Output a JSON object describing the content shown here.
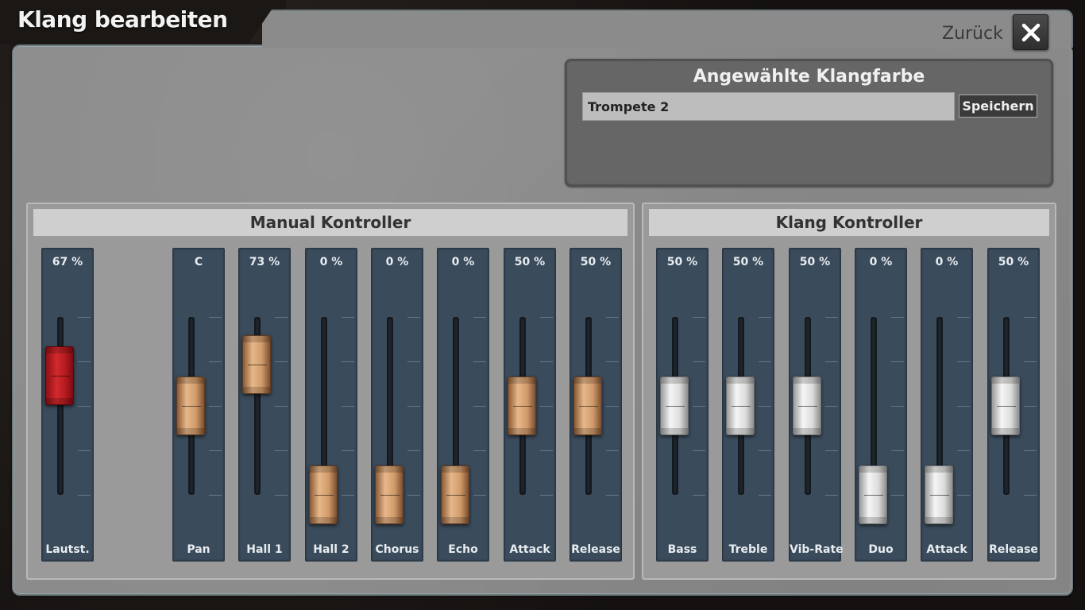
{
  "window": {
    "title": "Klang bearbeiten",
    "back_label": "Zurück",
    "close_icon": "close-icon"
  },
  "selected_sound": {
    "title": "Angewählte Klangfarbe",
    "name": "Trompete 2",
    "save_label": "Speichern"
  },
  "colors": {
    "panel": "#8b8b8b",
    "controller_bg": "#3a4b5c",
    "knob_volume": "#c41e23",
    "knob_manual": "#d9a577",
    "knob_sound": "#e6e6e6"
  },
  "manual_group": {
    "title": "Manual Kontroller",
    "controls": [
      {
        "label": "Lautst.",
        "value_text": "67 %",
        "level": 0.67,
        "style": "red"
      },
      {
        "label": "Pan",
        "value_text": "C",
        "level": 0.5,
        "style": "copper"
      },
      {
        "label": "Hall 1",
        "value_text": "73 %",
        "level": 0.73,
        "style": "copper"
      },
      {
        "label": "Hall 2",
        "value_text": "0 %",
        "level": 0.0,
        "style": "copper"
      },
      {
        "label": "Chorus",
        "value_text": "0 %",
        "level": 0.0,
        "style": "copper"
      },
      {
        "label": "Echo",
        "value_text": "0 %",
        "level": 0.0,
        "style": "copper"
      },
      {
        "label": "Attack",
        "value_text": "50 %",
        "level": 0.5,
        "style": "copper"
      },
      {
        "label": "Release",
        "value_text": "50 %",
        "level": 0.5,
        "style": "copper"
      }
    ]
  },
  "sound_group": {
    "title": "Klang Kontroller",
    "controls": [
      {
        "label": "Bass",
        "value_text": "50 %",
        "level": 0.5,
        "style": "silver"
      },
      {
        "label": "Treble",
        "value_text": "50 %",
        "level": 0.5,
        "style": "silver"
      },
      {
        "label": "Vib-Rate",
        "value_text": "50 %",
        "level": 0.5,
        "style": "silver"
      },
      {
        "label": "Duo",
        "value_text": "0 %",
        "level": 0.0,
        "style": "silver"
      },
      {
        "label": "Attack",
        "value_text": "0 %",
        "level": 0.0,
        "style": "silver"
      },
      {
        "label": "Release",
        "value_text": "50 %",
        "level": 0.5,
        "style": "silver"
      }
    ]
  }
}
